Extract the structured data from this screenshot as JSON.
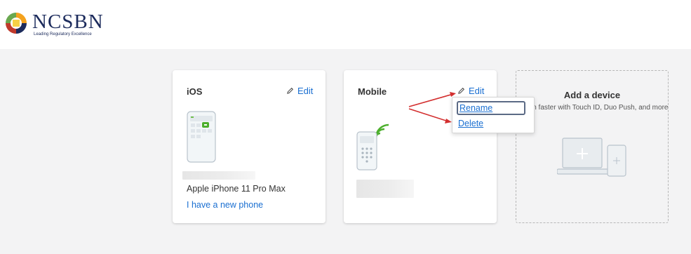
{
  "header": {
    "logo_text": "NCSBN",
    "logo_tagline": "Leading Regulatory Excellence"
  },
  "cards": [
    {
      "title": "iOS",
      "edit_label": "Edit",
      "device_name": "Apple iPhone 11 Pro Max",
      "new_phone_label": "I have a new phone"
    },
    {
      "title": "Mobile",
      "edit_label": "Edit"
    }
  ],
  "dropdown": {
    "rename_label": "Rename",
    "delete_label": "Delete"
  },
  "add_device": {
    "title": "Add a device",
    "description": "Log in faster with Touch ID, Duo Push, and more"
  },
  "colors": {
    "link": "#1a6fd1",
    "annotation_arrow": "#d32f2f",
    "background": "#f3f3f4",
    "brand": "#1c2b5c"
  }
}
